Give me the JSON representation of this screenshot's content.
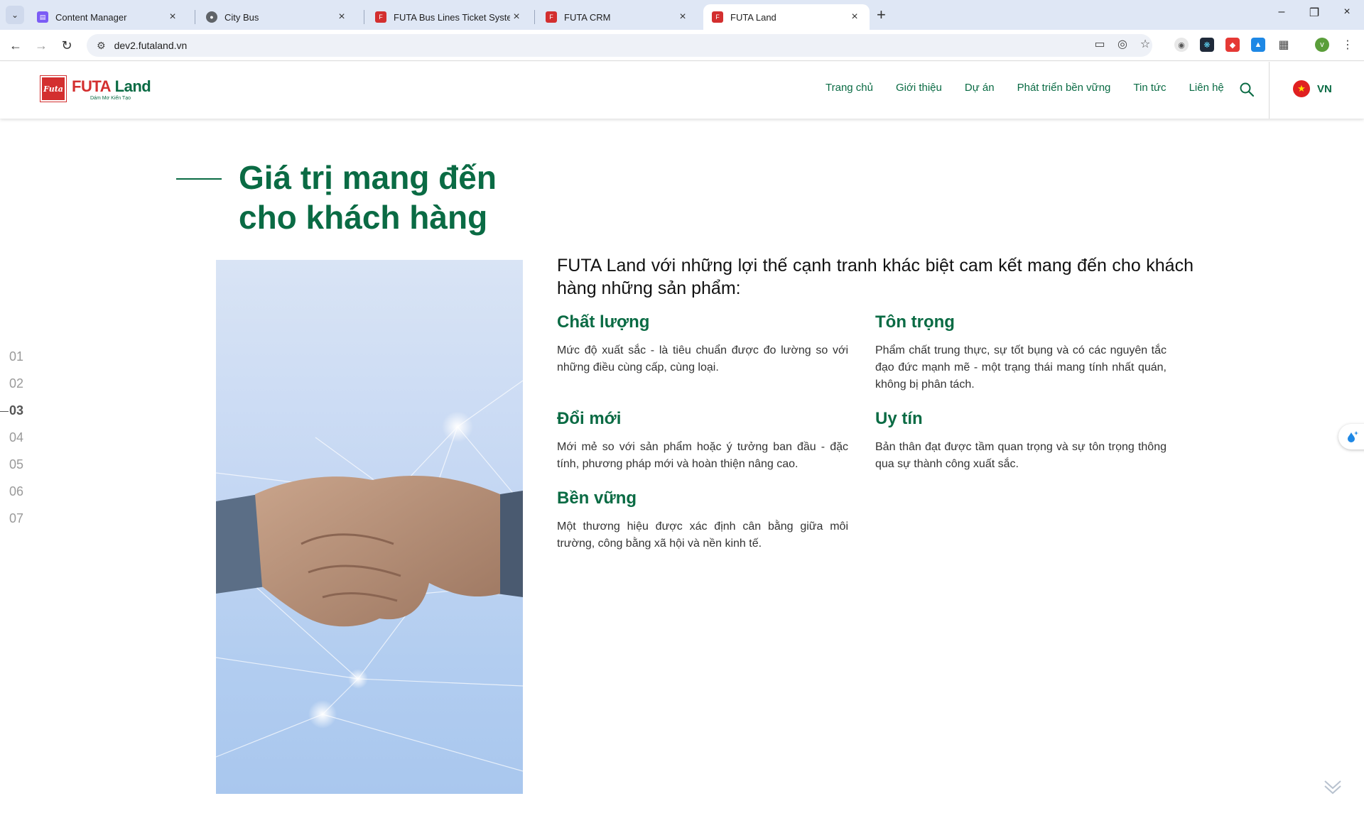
{
  "browser": {
    "tabs": [
      {
        "title": "Content Manager",
        "icon": "content-manager-icon",
        "color": "#7b5cf5"
      },
      {
        "title": "City Bus",
        "icon": "globe-icon",
        "color": "#5f6368"
      },
      {
        "title": "FUTA Bus Lines Ticket System",
        "icon": "futa-icon",
        "color": "#d32f2f"
      },
      {
        "title": "FUTA CRM",
        "icon": "futa-icon",
        "color": "#d32f2f"
      },
      {
        "title": "FUTA Land",
        "icon": "futa-icon",
        "color": "#d32f2f",
        "active": true
      }
    ],
    "url": "dev2.futaland.vn"
  },
  "site": {
    "logo": {
      "badge": "Futa",
      "name_left": "FUTA",
      "name_right": " Land",
      "slogan": "Dám Mơ Kiến Tạo"
    },
    "nav": [
      "Trang chủ",
      "Giới thiệu",
      "Dự án",
      "Phát triển bền vững",
      "Tin tức",
      "Liên hệ"
    ],
    "language": "VN"
  },
  "section": {
    "title_line1": "Giá trị mang đến",
    "title_line2": "cho khách hàng",
    "intro": "FUTA Land với những lợi thế cạnh tranh khác biệt cam kết mang đến cho khách hàng những sản phẩm:",
    "values": [
      {
        "title": "Chất lượng",
        "desc": "Mức độ xuất sắc - là tiêu chuẩn được đo lường so với những điều cùng cấp, cùng loại."
      },
      {
        "title": "Tôn trọng",
        "desc": "Phẩm chất trung thực, sự tốt bụng và có các nguyên tắc đạo đức mạnh mẽ - một trạng thái mang tính nhất quán, không bị phân tách."
      },
      {
        "title": "Đổi mới",
        "desc": "Mới mẻ so với sản phẩm hoặc ý tưởng ban đầu - đặc tính, phương pháp mới và hoàn thiện nâng cao."
      },
      {
        "title": "Uy tín",
        "desc": "Bản thân đạt được tầm quan trọng và sự tôn trọng thông qua sự thành công xuất sắc."
      },
      {
        "title": "Bền vững",
        "desc": "Một thương hiệu được xác định cân bằng giữa môi trường, công bằng xã hội và nền kinh tế."
      }
    ],
    "index": [
      "01",
      "02",
      "03",
      "04",
      "05",
      "06",
      "07"
    ],
    "active_index": "03"
  },
  "colors": {
    "brand_green": "#0a6b44",
    "brand_red": "#d32f2f"
  }
}
